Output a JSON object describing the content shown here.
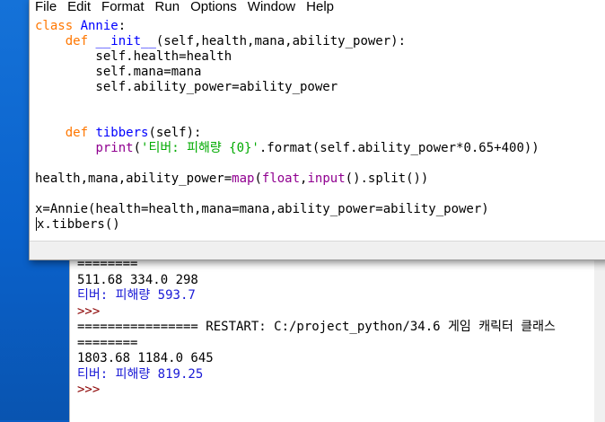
{
  "menu": {
    "items": [
      "File",
      "Edit",
      "Format",
      "Run",
      "Options",
      "Window",
      "Help"
    ]
  },
  "editor": {
    "lines": [
      {
        "segments": [
          {
            "t": "class ",
            "c": "kw"
          },
          {
            "t": "Annie",
            "c": "def-name"
          },
          {
            "t": ":",
            "c": ""
          }
        ]
      },
      {
        "segments": [
          {
            "t": "    ",
            "c": ""
          },
          {
            "t": "def ",
            "c": "kw"
          },
          {
            "t": "__init__",
            "c": "def-name"
          },
          {
            "t": "(self,health,mana,ability_power):",
            "c": ""
          }
        ]
      },
      {
        "segments": [
          {
            "t": "        self.health=health",
            "c": ""
          }
        ]
      },
      {
        "segments": [
          {
            "t": "        self.mana=mana",
            "c": ""
          }
        ]
      },
      {
        "segments": [
          {
            "t": "        self.ability_power=ability_power",
            "c": ""
          }
        ]
      },
      {
        "segments": [
          {
            "t": "",
            "c": ""
          }
        ]
      },
      {
        "segments": [
          {
            "t": "",
            "c": ""
          }
        ]
      },
      {
        "segments": [
          {
            "t": "    ",
            "c": ""
          },
          {
            "t": "def ",
            "c": "kw"
          },
          {
            "t": "tibbers",
            "c": "def-name"
          },
          {
            "t": "(self):",
            "c": ""
          }
        ]
      },
      {
        "segments": [
          {
            "t": "        ",
            "c": ""
          },
          {
            "t": "print",
            "c": "builtin"
          },
          {
            "t": "(",
            "c": ""
          },
          {
            "t": "'티버: 피해량 {0}'",
            "c": "str"
          },
          {
            "t": ".format(self.ability_power*0.65+400))",
            "c": ""
          }
        ]
      },
      {
        "segments": [
          {
            "t": "",
            "c": ""
          }
        ]
      },
      {
        "segments": [
          {
            "t": "health,mana,ability_power=",
            "c": ""
          },
          {
            "t": "map",
            "c": "builtin"
          },
          {
            "t": "(",
            "c": ""
          },
          {
            "t": "float",
            "c": "builtin"
          },
          {
            "t": ",",
            "c": ""
          },
          {
            "t": "input",
            "c": "builtin"
          },
          {
            "t": "().split())",
            "c": ""
          }
        ]
      },
      {
        "segments": [
          {
            "t": "",
            "c": ""
          }
        ]
      },
      {
        "segments": [
          {
            "t": "x=Annie(health=health,mana=mana,ability_power=ability_power)",
            "c": ""
          }
        ]
      },
      {
        "segments": [
          {
            "t": "x.tibbers()",
            "c": ""
          }
        ]
      }
    ]
  },
  "shell": {
    "lines": [
      {
        "text": "========",
        "c": "c-out"
      },
      {
        "text": "511.68 334.0 298",
        "c": "c-out"
      },
      {
        "text": "티버: 피해량 593.7",
        "c": "c-stdout"
      },
      {
        "text": ">>>",
        "c": "c-prompt"
      },
      {
        "text": "================ RESTART: C:/project_python/34.6 게임 캐릭터 클래스",
        "c": "c-restart"
      },
      {
        "text": "========",
        "c": "c-out"
      },
      {
        "text": "1803.68 1184.0 645",
        "c": "c-out"
      },
      {
        "text": "티버: 피해량 819.25",
        "c": "c-stdout"
      },
      {
        "text": ">>>",
        "c": "c-prompt"
      }
    ]
  }
}
